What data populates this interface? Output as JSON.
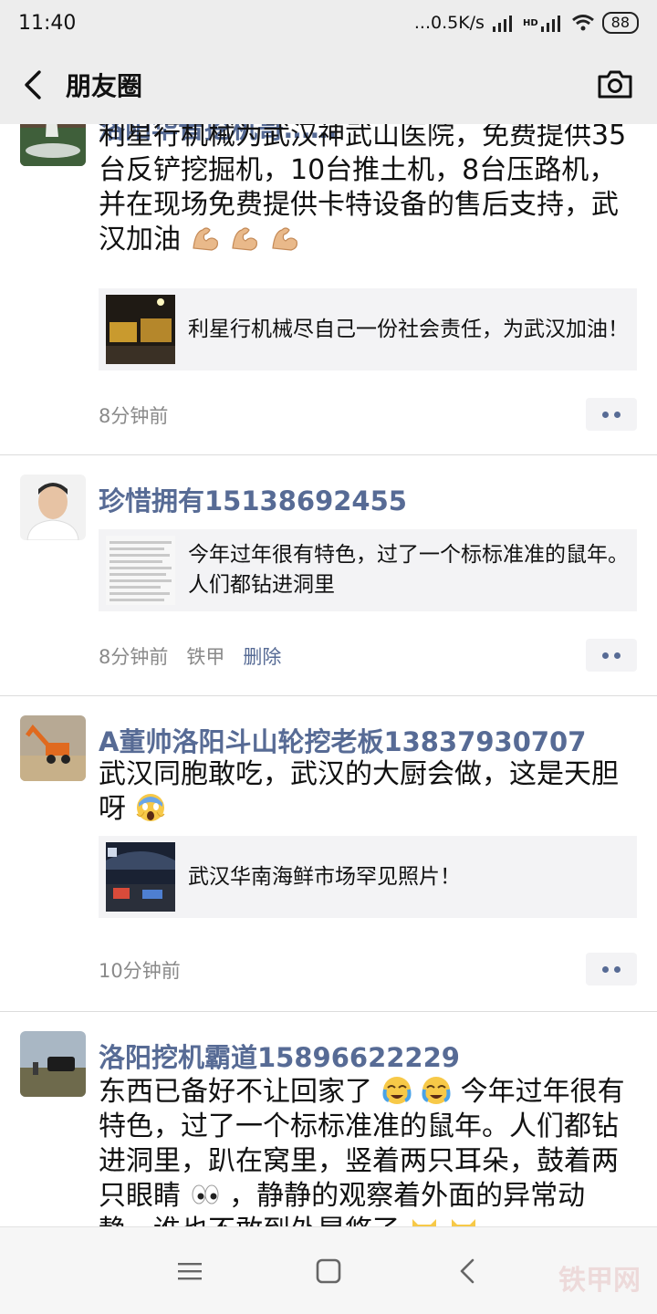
{
  "status_bar": {
    "time": "11:40",
    "network_speed": "...0.5K/s",
    "hd_label": "HD",
    "battery": "88"
  },
  "nav": {
    "title": "朋友圈",
    "back_icon": "chevron-left-icon",
    "camera_icon": "camera-icon"
  },
  "posts": [
    {
      "name": "洛阳华晋挖机哥……",
      "text": "利星行机械为武汉神武山医院，免费提供35台反铲挖掘机，10台推土机，8台压路机，并在现场免费提供卡特设备的售后支持，武汉加油",
      "emojis": [
        "flexed-biceps",
        "flexed-biceps",
        "flexed-biceps"
      ],
      "link": "利星行机械尽自己一份社会责任，为武汉加油！",
      "time": "8分钟前"
    },
    {
      "name": "珍惜拥有15138692455",
      "link": "今年过年很有特色，过了一个标标准准的鼠年。人们都钻进洞里",
      "time": "8分钟前",
      "source": "铁甲",
      "delete_label": "删除"
    },
    {
      "name": "A董帅洛阳斗山轮挖老板13837930707",
      "text": "武汉同胞敢吃，武汉的大厨会做，这是天胆呀",
      "emojis": [
        "screaming-face"
      ],
      "link": "武汉华南海鲜市场罕见照片！",
      "time": "10分钟前"
    },
    {
      "name": "洛阳挖机霸道15896622229",
      "text_parts": [
        "东西已备好不让回家了",
        "今年过年很有特色，过了一个标标准准的鼠年。人们都钻进洞里，趴在窝里，竖着两只耳朵，鼓着两只眼睛",
        "，静静的观察着外面的异常动静，谁也不敢到外晃悠了"
      ],
      "emojis": [
        "crying-face",
        "crying-face",
        "eyes",
        "grinning-cat",
        "grinning-cat"
      ]
    }
  ],
  "bottom_nav": {
    "menu_icon": "menu-icon",
    "home_icon": "home-square-icon",
    "back_icon": "back-triangle-icon"
  },
  "watermark": "铁甲网",
  "colors": {
    "link_name": "#576b95",
    "header_bg": "#ededed",
    "card_bg": "#f3f3f5"
  }
}
